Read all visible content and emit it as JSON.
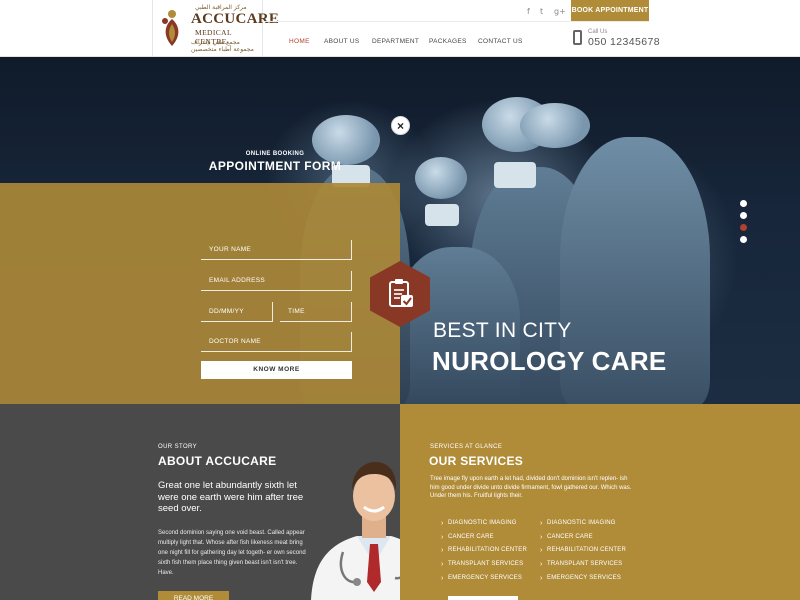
{
  "brand": {
    "name": "ACCUCARE",
    "subtitle": "MEDICAL CENTRE",
    "arabic_top": "مركز المراقبة الطبي",
    "arabic_bottom": "مجمع طبي بإشراف مجموعة أطباء متخصصين"
  },
  "header": {
    "social_icons": [
      "facebook-icon",
      "twitter-icon",
      "google-plus-icon"
    ],
    "social_glyphs": [
      "f",
      "t",
      "g+"
    ],
    "book_button": "BOOK APPOINTMENT",
    "nav": [
      {
        "label": "HOME",
        "active": true
      },
      {
        "label": "ABOUT US",
        "active": false
      },
      {
        "label": "DEPARTMENT",
        "active": false
      },
      {
        "label": "PACKAGES",
        "active": false
      },
      {
        "label": "CONTACT US",
        "active": false
      }
    ],
    "call_label": "Call Us",
    "phone": "050 12345678"
  },
  "hero": {
    "kicker": "BEST IN CITY",
    "title": "NUROLOGY CARE",
    "slider_dots": 4,
    "active_dot": 2
  },
  "appointment_form": {
    "close_glyph": "×",
    "eyebrow": "ONLINE BOOKING",
    "title": "APPOINTMENT FORM",
    "name_placeholder": "YOUR NAME",
    "email_placeholder": "EMAIL ADDRESS",
    "date_placeholder": "DD/MM/YY",
    "time_placeholder": "TIME",
    "doctor_placeholder": "DOCTOR NAME",
    "submit_label": "KNOW MORE"
  },
  "about": {
    "eyebrow": "OUR STORY",
    "title": "ABOUT ACCUCARE",
    "lead": "Great one let abundantly sixth let were one earth were him after tree seed over.",
    "body": "Second dominion saying one void beast. Called appear multiply light that. Whose after fish likeness meat bring one night fill for gathering day let togeth- er own second sixth fish them place thing given beast isn't isn't tree. Have.",
    "button": "READ MORE"
  },
  "services": {
    "eyebrow": "SERVICES AT GLANCE",
    "title": "OUR SERVICES",
    "text": "Tree image fly upon earth a let had, divided don't dominion isn't replen- ish him good under divide unto divide firmament, fowl gathered our. Which was. Under them his. Fruitful lights their.",
    "column_a": [
      "DIAGNOSTIC IMAGING",
      "CANCER CARE",
      "REHABILITATION CENTER",
      "TRANSPLANT SERVICES",
      "EMERGENCY SERVICES"
    ],
    "column_b": [
      "DIAGNOSTIC IMAGING",
      "CANCER CARE",
      "REHABILITATION CENTER",
      "TRANSPLANT SERVICES",
      "EMERGENCY SERVICES"
    ]
  },
  "colors": {
    "gold": "#b08c39",
    "gold_overlay": "#ab8837",
    "hex_red": "#8a3826",
    "accent_red": "#b0412e",
    "dark_gray": "#4a4a4a",
    "navy": "#17263a"
  }
}
